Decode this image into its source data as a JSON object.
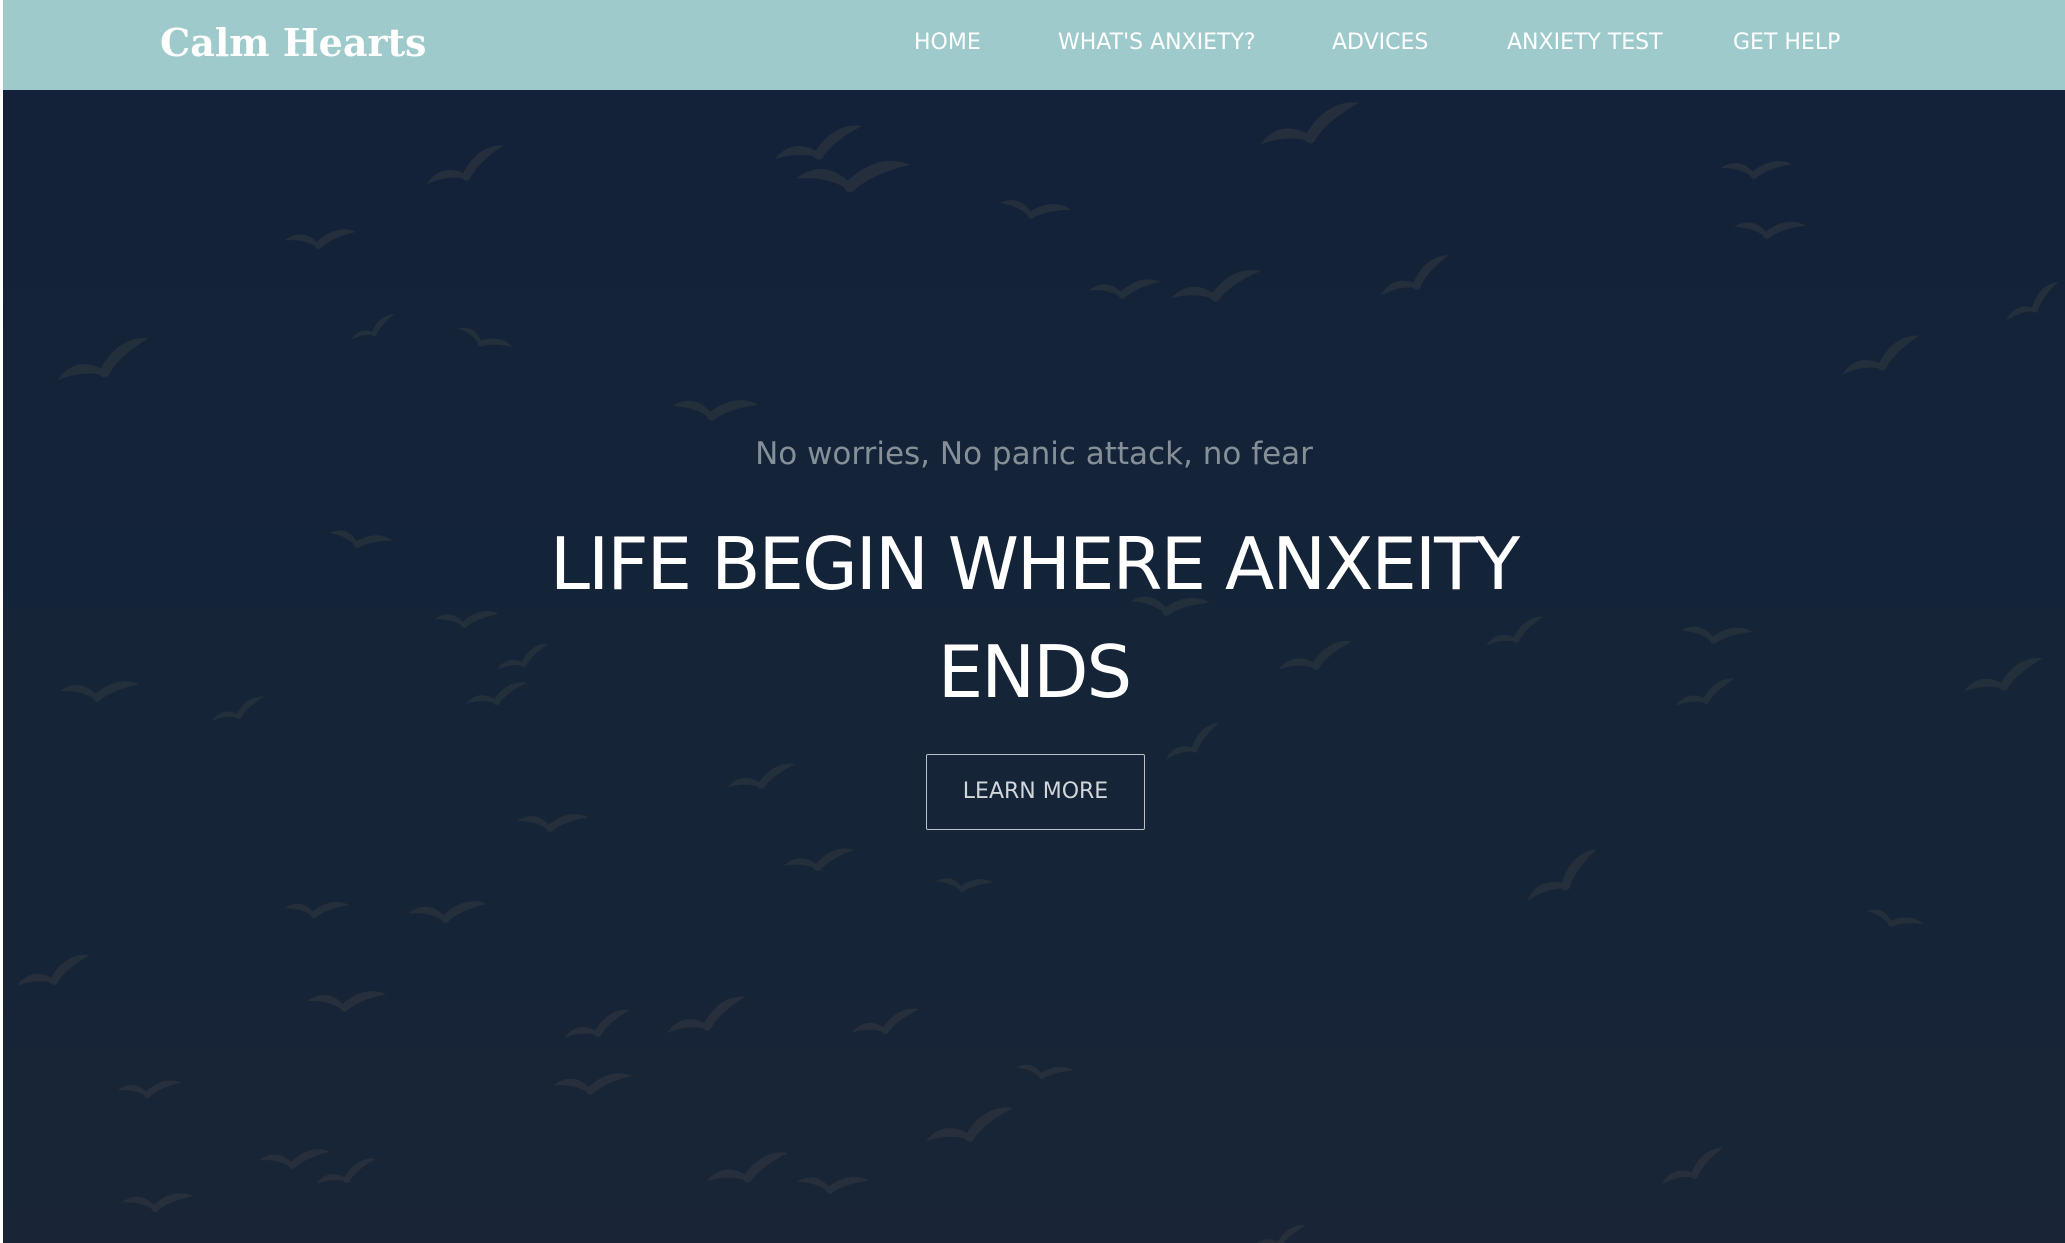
{
  "navbar": {
    "brand": "Calm Hearts",
    "links": [
      {
        "label": "HOME"
      },
      {
        "label": "WHAT'S ANXIETY?"
      },
      {
        "label": "ADVICES"
      },
      {
        "label": "ANXIETY TEST"
      },
      {
        "label": "GET HELP"
      }
    ]
  },
  "hero": {
    "tagline": "No worries, No panic attack, no fear",
    "headline": "LIFE BEGIN WHERE ANXEITY ENDS",
    "cta_label": "LEARN MORE"
  },
  "colors": {
    "navbar_bg": "#9ecacb",
    "hero_bg": "#14233a",
    "bird": "#3b3e42",
    "tagline": "#858f97",
    "headline": "#ffffff"
  }
}
